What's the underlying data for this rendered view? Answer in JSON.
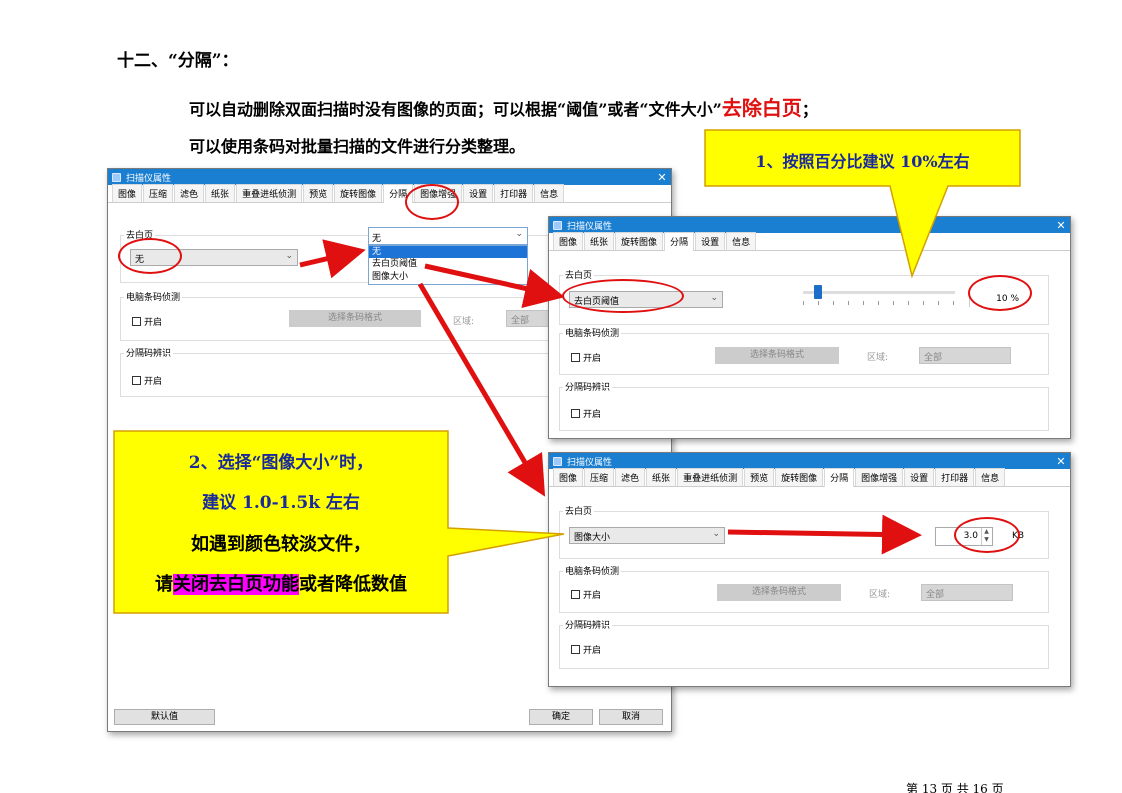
{
  "heading": "十二、“分隔”：",
  "intro": {
    "line1_pre": "可以自动删除双面扫描时没有图像的页面；可以根据“阈值”或者“文件大小”",
    "line1_red": "去除白页",
    "line1_post": "；",
    "line2": "可以使用条码对批量扫描的文件进行分类整理。"
  },
  "main_dialog": {
    "title": "扫描仪属性",
    "tabs": [
      "图像",
      "压缩",
      "滤色",
      "纸张",
      "重叠进纸侦测",
      "预览",
      "旋转图像",
      "分隔",
      "图像增强",
      "设置",
      "打印器",
      "信息"
    ],
    "active_tab": "分隔",
    "blank_group": "去白页",
    "blank_value": "无",
    "dropdown_value": "无",
    "dropdown_options": [
      "无",
      "去白页阈值",
      "图像大小"
    ],
    "barcode_group": "电脑条码侦测",
    "enable": "开启",
    "barcode_btn": "选择条码格式",
    "area_label": "区域:",
    "area_value": "全部",
    "sep_group": "分隔码辨识",
    "default_btn": "默认值",
    "ok_btn": "确定",
    "cancel_btn": "取消"
  },
  "dialog_threshold": {
    "title": "扫描仪属性",
    "tabs": [
      "图像",
      "纸张",
      "旋转图像",
      "分隔",
      "设置",
      "信息"
    ],
    "active_tab": "分隔",
    "blank_group": "去白页",
    "blank_value": "去白页阈值",
    "slider_value": "10 %",
    "slider_fraction": 0.1,
    "barcode_group": "电脑条码侦测",
    "enable": "开启",
    "barcode_btn": "选择条码格式",
    "area_label": "区域:",
    "area_value": "全部",
    "sep_group": "分隔码辨识"
  },
  "dialog_size": {
    "title": "扫描仪属性",
    "tabs": [
      "图像",
      "压缩",
      "滤色",
      "纸张",
      "重叠进纸侦测",
      "预览",
      "旋转图像",
      "分隔",
      "图像增强",
      "设置",
      "打印器",
      "信息"
    ],
    "active_tab": "分隔",
    "blank_group": "去白页",
    "blank_value": "图像大小",
    "size_value": "3.0",
    "size_unit": "KB",
    "barcode_group": "电脑条码侦测",
    "enable": "开启",
    "barcode_btn": "选择条码格式",
    "area_label": "区域:",
    "area_value": "全部",
    "sep_group": "分隔码辨识"
  },
  "callout1": "1、按照百分比建议 10%左右",
  "callout2": {
    "line1": "2、选择“图像大小”时，",
    "line2": "建议 1.0-1.5k 左右",
    "line3": "如遇到颜色较淡文件，",
    "line4_pre": "请",
    "line4_highlight": "关闭去白页功能",
    "line4_post": "或者降低数值"
  },
  "page_number": "第 13 页 共 16 页",
  "colors": {
    "callout_fill": "#ffff00",
    "callout_text": "#1a2a9a",
    "highlight": "#ff00ff",
    "arrow": "#e01010",
    "titlebar": "#1b7fd1"
  }
}
